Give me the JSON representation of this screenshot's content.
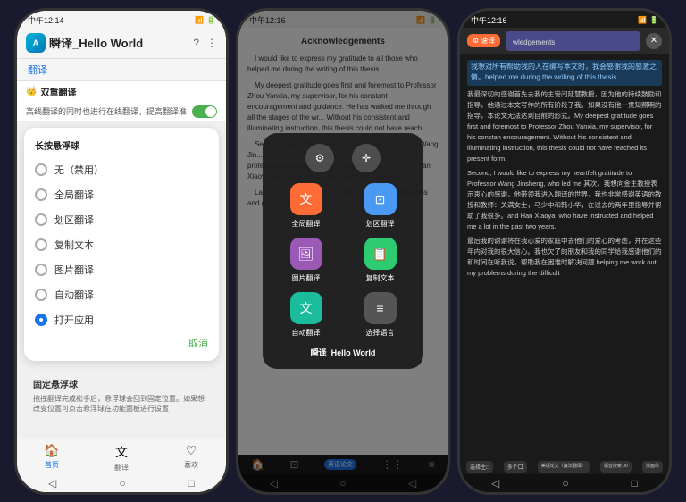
{
  "phones": [
    {
      "id": "phone1",
      "statusBar": {
        "time": "中午12:14",
        "signal": "▌▌▌",
        "wifi": "WiFi",
        "battery": "⬛"
      },
      "header": {
        "appName": "瞬译_Hello World",
        "icon": "A"
      },
      "navLabel": "翻译",
      "dualTranslate": {
        "label": "双重翻译",
        "crownIcon": "👑"
      },
      "toggleText": "高线翻译的同时也进行在线翻译，提高翻译准",
      "floatingMenu": {
        "title": "长按悬浮球",
        "items": [
          {
            "label": "无（禁用）",
            "selected": false
          },
          {
            "label": "全局翻译",
            "selected": false
          },
          {
            "label": "划区翻译",
            "selected": false
          },
          {
            "label": "复制文本",
            "selected": false
          },
          {
            "label": "图片翻译",
            "selected": false
          },
          {
            "label": "自动翻译",
            "selected": false
          },
          {
            "label": "打开应用",
            "selected": true
          }
        ],
        "cancelLabel": "取消"
      },
      "fixedBall": {
        "title": "固定悬浮球",
        "desc": "拖拽翻译完成松手后，悬浮球会回到固定位置。如果想改变位置可点击悬浮球在功能面板进行设置"
      },
      "bottomNav": [
        {
          "icon": "🏠",
          "label": "首页",
          "active": true
        },
        {
          "icon": "文",
          "label": "翻译",
          "active": false
        },
        {
          "icon": "♡",
          "label": "喜欢",
          "active": false
        }
      ]
    },
    {
      "id": "phone2",
      "statusBar": {
        "time": "中午12:16",
        "signal": "▌▌▌",
        "wifi": "WiFi",
        "battery": "⬛"
      },
      "document": {
        "title": "Acknowledgements",
        "paragraphs": [
          "I would like to express my gratitude to all those who helped me during the writing of this thesis.",
          "My deepest gratitude goes first and foremost to Professor Zhou Yanxia, my supervisor, for his constant encouragement and guidance. He has walked me through all the stages of the wr... Without his consistent and illuminating instruction, this thesis could not have reach...",
          "Second, I would like to expr... gratitude to Professor Wang Jin... into the world of translation. I a... indebted to the professors and Department of English: Ms. Wu... and Han Xiaoya, who have instr... lot in the past two years.",
          "Last my thanks would go t... their loving considerations and g... me all through these years. I also owe my sincere gratitude to my friends and my fellow classmates who gave me their help and time in listening to me and helping me work out my problems during the difficult"
        ]
      },
      "floatMenu": {
        "topIcons": [
          "⚙",
          "✛"
        ],
        "gridItems": [
          {
            "icon": "文",
            "label": "全局翻译",
            "color": "orange"
          },
          {
            "icon": "⊡",
            "label": "划区翻译",
            "color": "blue"
          },
          {
            "icon": "🖼",
            "label": "图片翻译",
            "color": "purple"
          },
          {
            "icon": "📋",
            "label": "复制文本",
            "color": "green"
          },
          {
            "icon": "文",
            "label": "自动翻译",
            "color": "teal"
          },
          {
            "icon": "≡",
            "label": "选择语言",
            "color": "dark"
          }
        ],
        "appTitle": "瞬译_Hello World"
      },
      "bottomNav": {
        "items": [
          "🏠",
          "⊡",
          "英语论文",
          "⋮⋮",
          "≡"
        ]
      }
    },
    {
      "id": "phone3",
      "statusBar": {
        "time": "中午12:16",
        "signal": "▌▌▌",
        "wifi": "WiFi",
        "battery": "⬛"
      },
      "header": {
        "settingsLabel": "⚙速译",
        "closeBtn": "✕"
      },
      "highlightedTitle": "wledgements",
      "chineseText": {
        "paragraphs": [
          "我想对所有帮助我的人在编写本文时，我会感谢我的感激之情。helped me during the writing of this thesis.",
          "我最深切的感谢首先去我的主管闫延慧教授，因为他的持续鼓励和指导，他通过本文写作的所有阶段了我。如果没有他一贯知照明的指导，本论文无法达到目前的形式。My deepest gratitude goes first and foremost to Professor Zhou Yanxia, my supervisor, for his constan encouragement and guidance. Without his consistent and illuminating instruction, this thesis could not have reached its present form.",
          "Second, I would like to express my heartfelt gratitude to Professor Wang Jinsheng, who led me 其次，我想向金主教授表示衷心的感谢，他带领我进入翻译的世界，我也非常感谢英语的教授和教师：关满女士，马少中和韩小华，在过去的两年里指导并帮助了我很多。Suzhou and Han Xiaoya, who have instructed and helped me a lot in the past two years.",
          "Last my thanks would go to my beloved family for their loving considerations and great confidence in 最后我的谢谢将在我心爱的家庭中去他们的爱心的考虑，并在这些年内对我的很大信心。我也欠了的朋友和我的同学给我感谢他们的和时间在听我说，帮助我在困难时解决问题 helping me work out my problems during the difficult"
        ]
      },
      "toolbar": {
        "items": [
          {
            "label": "选择主□",
            "active": false
          },
          {
            "label": "多个口",
            "active": false
          },
          {
            "label": "美语论文（第位魔法翻译）",
            "active": false
          },
          {
            "label": "语音搜索 00",
            "active": false
          },
          {
            "label": "漫画单",
            "active": false
          }
        ]
      },
      "bottomNav": [
        "◁",
        "○",
        "□"
      ]
    }
  ]
}
